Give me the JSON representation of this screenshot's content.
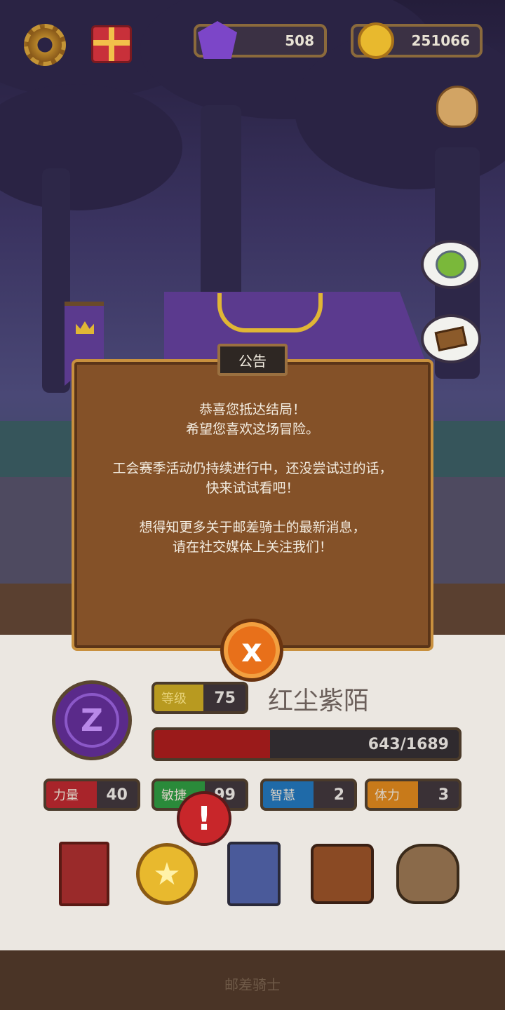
{
  "hud": {
    "gems": "508",
    "coins": "251066",
    "icons": [
      "gear-icon",
      "gift-icon",
      "gem-icon",
      "coin-icon",
      "pouch-icon"
    ]
  },
  "side_buttons": [
    "potion-upgrade-icon",
    "signpost-icon"
  ],
  "dialog": {
    "title": "公告",
    "lines": {
      "p1a": "恭喜您抵达结局！",
      "p1b": "希望您喜欢这场冒险。",
      "p2a": "工会赛季活动仍持续进行中，还没尝试过的话，",
      "p2b": "快来试试看吧！",
      "p3a": "想得知更多关于邮差骑士的最新消息，",
      "p3b": "请在社交媒体上关注我们！"
    },
    "close_icon": "x"
  },
  "player": {
    "avatar_letter": "Z",
    "level_label": "等级",
    "level": "75",
    "name": "红尘紫陌",
    "hp_text": "643/1689",
    "hp_fraction": 0.381
  },
  "attributes": {
    "str_label": "力量",
    "str": "40",
    "agi_label": "敏捷",
    "agi": "99",
    "int_label": "智慧",
    "int": "2",
    "vit_label": "体力",
    "vit": "3"
  },
  "alert_mark": "!",
  "menu": [
    "book-icon",
    "medal-icon",
    "cards-icon",
    "bag-icon",
    "loot-icon"
  ],
  "medal_star": "★",
  "footer": "邮差骑士",
  "colors": {
    "panel": "#ebe7e1",
    "dialog": "#845128",
    "hp": "#9a1a1a",
    "close": "#e8701a"
  }
}
